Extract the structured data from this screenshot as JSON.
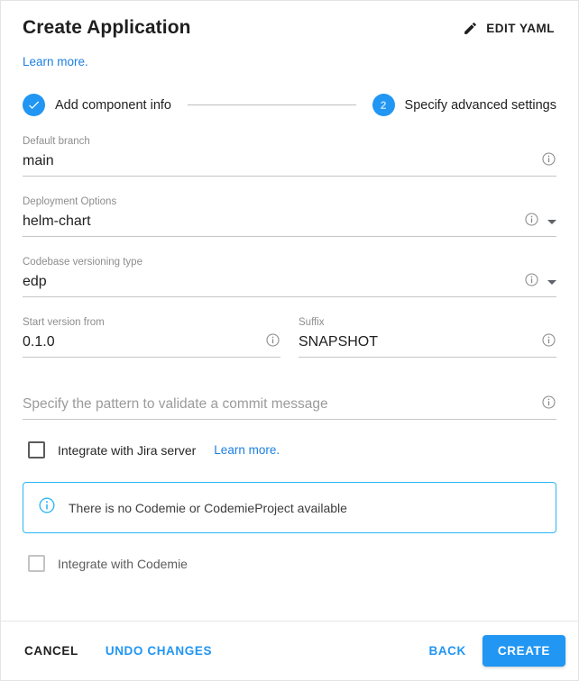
{
  "header": {
    "title": "Create Application",
    "edit_yaml_label": "EDIT YAML",
    "edit_yaml_icon": "pencil-icon"
  },
  "learn_more_top": {
    "label": "Learn more."
  },
  "stepper": {
    "steps": [
      {
        "label": "Add component info",
        "state": "completed",
        "icon": "check-icon"
      },
      {
        "label": "Specify advanced settings",
        "state": "active",
        "number": "2"
      }
    ]
  },
  "form": {
    "default_branch": {
      "label": "Default branch",
      "value": "main",
      "info_icon": "info-icon"
    },
    "deployment_options": {
      "label": "Deployment Options",
      "value": "helm-chart",
      "info_icon": "info-icon",
      "caret_icon": "chevron-down-icon"
    },
    "codebase_versioning_type": {
      "label": "Codebase versioning type",
      "value": "edp",
      "info_icon": "info-icon",
      "caret_icon": "chevron-down-icon"
    },
    "start_version_from": {
      "label": "Start version from",
      "value": "0.1.0",
      "info_icon": "info-icon"
    },
    "suffix": {
      "label": "Suffix",
      "value": "SNAPSHOT",
      "info_icon": "info-icon"
    },
    "commit_pattern": {
      "placeholder": "Specify the pattern to validate a commit message",
      "value": "",
      "info_icon": "info-icon"
    },
    "jira_checkbox": {
      "label": "Integrate with Jira server",
      "checked": false,
      "link_label": "Learn more."
    },
    "codemie_checkbox": {
      "label": "Integrate with Codemie",
      "checked": false,
      "disabled": true
    }
  },
  "alert": {
    "text": "There is no Codemie or CodemieProject available",
    "icon": "info-circle-icon",
    "color": "#29b6f6"
  },
  "footer": {
    "cancel_label": "CANCEL",
    "undo_label": "UNDO CHANGES",
    "back_label": "BACK",
    "create_label": "CREATE"
  },
  "colors": {
    "accent": "#2196f3",
    "link": "#1d7fe0",
    "alert_border": "#29b6f6",
    "label": "#8d8d8d",
    "text": "#212121"
  }
}
